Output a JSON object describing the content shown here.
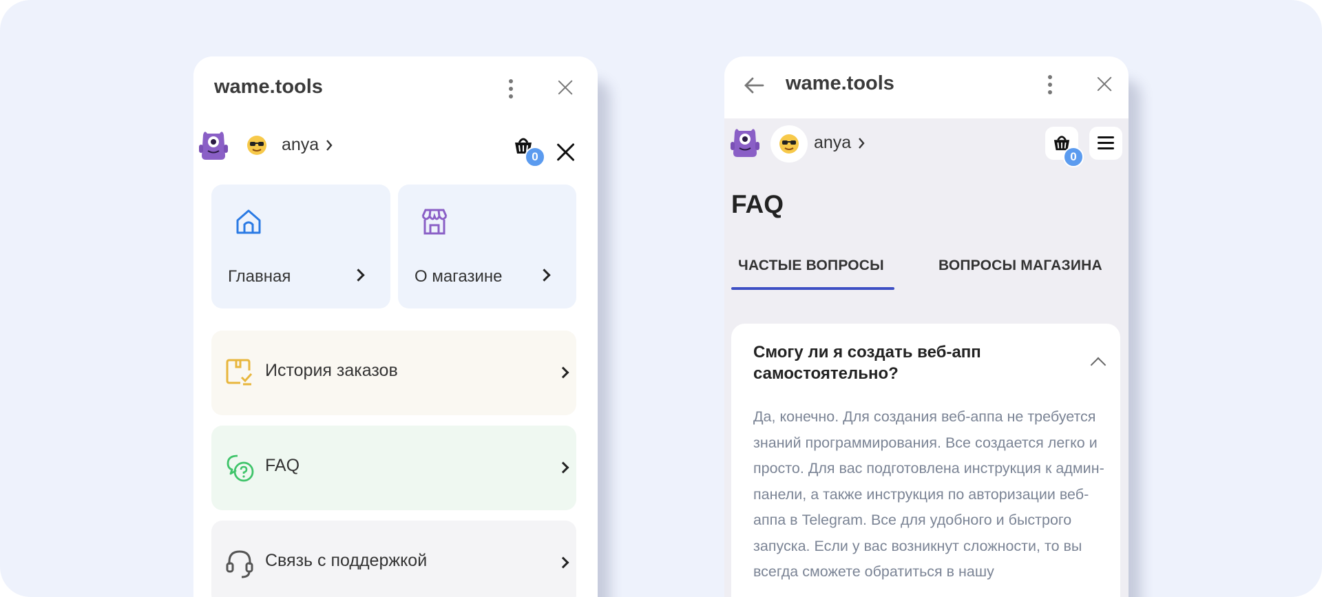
{
  "left_panel": {
    "app_title": "wame.tools",
    "user": {
      "name": "anya",
      "cart_count": "0"
    },
    "tiles": [
      {
        "label": "Главная"
      },
      {
        "label": "О магазине"
      }
    ],
    "menu": [
      {
        "label": "История заказов",
        "bg": "#faf8f2",
        "icon_color": "#e8b63c"
      },
      {
        "label": "FAQ",
        "bg": "#eff8f1",
        "icon_color": "#3fc46a"
      },
      {
        "label": "Связь с поддержкой",
        "bg": "#f4f4f6",
        "icon_color": "#555555"
      }
    ]
  },
  "right_panel": {
    "app_title": "wame.tools",
    "user": {
      "name": "anya",
      "cart_count": "0"
    },
    "page_title": "FAQ",
    "tabs": [
      {
        "label": "ЧАСТЫЕ ВОПРОСЫ",
        "active": true
      },
      {
        "label": "ВОПРОСЫ МАГАЗИНА",
        "active": false
      }
    ],
    "faq": {
      "question": "Смогу ли я создать веб-апп самостоятельно?",
      "answer": "Да, конечно. Для создания веб-аппа не требуется знаний программирования. Все создается легко и просто. Для вас подготовлена инструкция к админ-панели, а также инструкция по авторизации веб-аппа в Telegram. Все для удобного и быстрого запуска. Если у вас возникнут сложности, то вы всегда сможете обратиться в нашу"
    }
  },
  "colors": {
    "background": "#eef2fc",
    "accent": "#3d4fc4",
    "badge": "#5b9bef",
    "mascot": "#8a5fc6"
  }
}
